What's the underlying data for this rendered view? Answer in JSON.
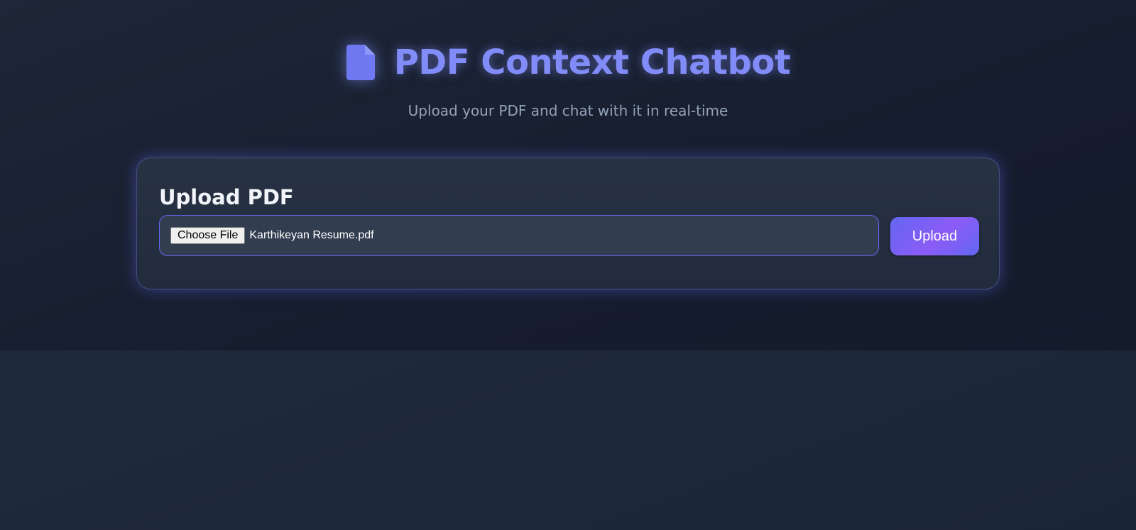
{
  "header": {
    "icon": "document-icon",
    "title": "PDF Context Chatbot",
    "subtitle": "Upload your PDF and chat with it in real-time"
  },
  "upload_card": {
    "title": "Upload PDF",
    "choose_file_label": "Choose File",
    "selected_file": "Karthikeyan Resume.pdf",
    "upload_label": "Upload"
  },
  "colors": {
    "accent": "#818cf8",
    "button_gradient_start": "#6366f1",
    "button_gradient_mid": "#8b5cf6",
    "background": "#1e293b"
  }
}
